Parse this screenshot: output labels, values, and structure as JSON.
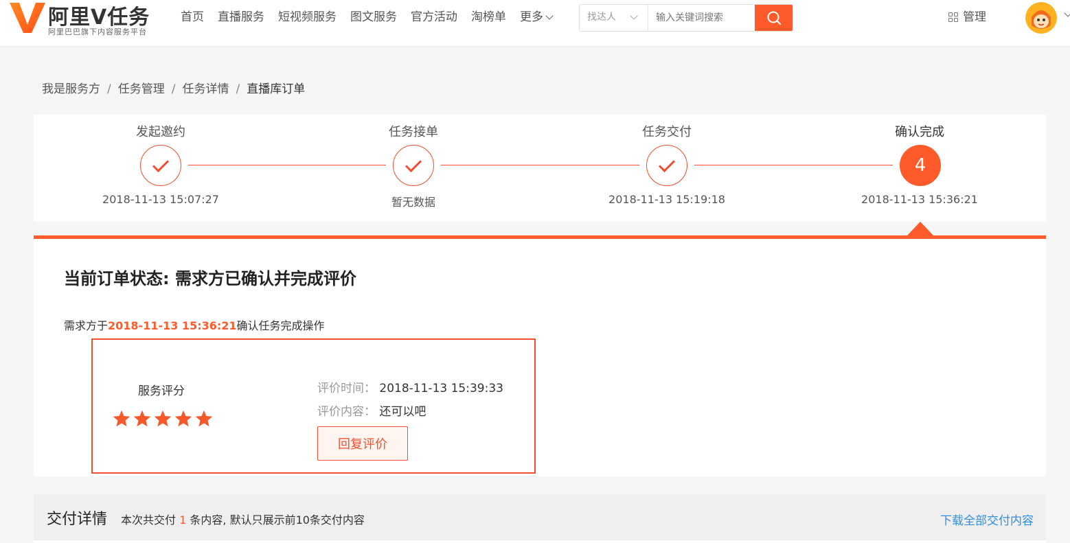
{
  "header": {
    "logo_title": "阿里V任务",
    "logo_subtitle": "阿里巴巴旗下内容服务平台",
    "nav": [
      "首页",
      "直播服务",
      "短视频服务",
      "图文服务",
      "官方活动",
      "淘榜单"
    ],
    "nav_more": "更多",
    "search_category": "找达人",
    "search_placeholder": "输入关键词搜索",
    "manage_label": "管理",
    "brand_color": "#ff5a29"
  },
  "breadcrumb": {
    "items": [
      "我是服务方",
      "任务管理",
      "任务详情"
    ],
    "current": "直播库订单"
  },
  "steps": [
    {
      "title": "发起邀约",
      "time": "2018-11-13 15:07:27",
      "state": "done"
    },
    {
      "title": "任务接单",
      "time": "暂无数据",
      "state": "done"
    },
    {
      "title": "任务交付",
      "time": "2018-11-13 15:19:18",
      "state": "done"
    },
    {
      "title": "确认完成",
      "time": "2018-11-13 15:36:21",
      "state": "active",
      "number": "4"
    }
  ],
  "status": {
    "title": "当前订单状态: 需求方已确认并完成评价",
    "desc_prefix": "需求方于",
    "desc_time": "2018-11-13 15:36:21",
    "desc_suffix": "确认任务完成操作"
  },
  "review": {
    "rating_label": "服务评分",
    "rating": 5,
    "rating_max": 5,
    "time_label": "评价时间：",
    "time_value": "2018-11-13 15:39:33",
    "content_label": "评价内容：",
    "content_value": "还可以吧",
    "reply_button": "回复评价"
  },
  "delivery": {
    "title": "交付详情",
    "desc_prefix": "本次共交付",
    "count": "1",
    "desc_suffix": "条内容, 默认只展示前10条交付内容",
    "download_link": "下载全部交付内容"
  }
}
